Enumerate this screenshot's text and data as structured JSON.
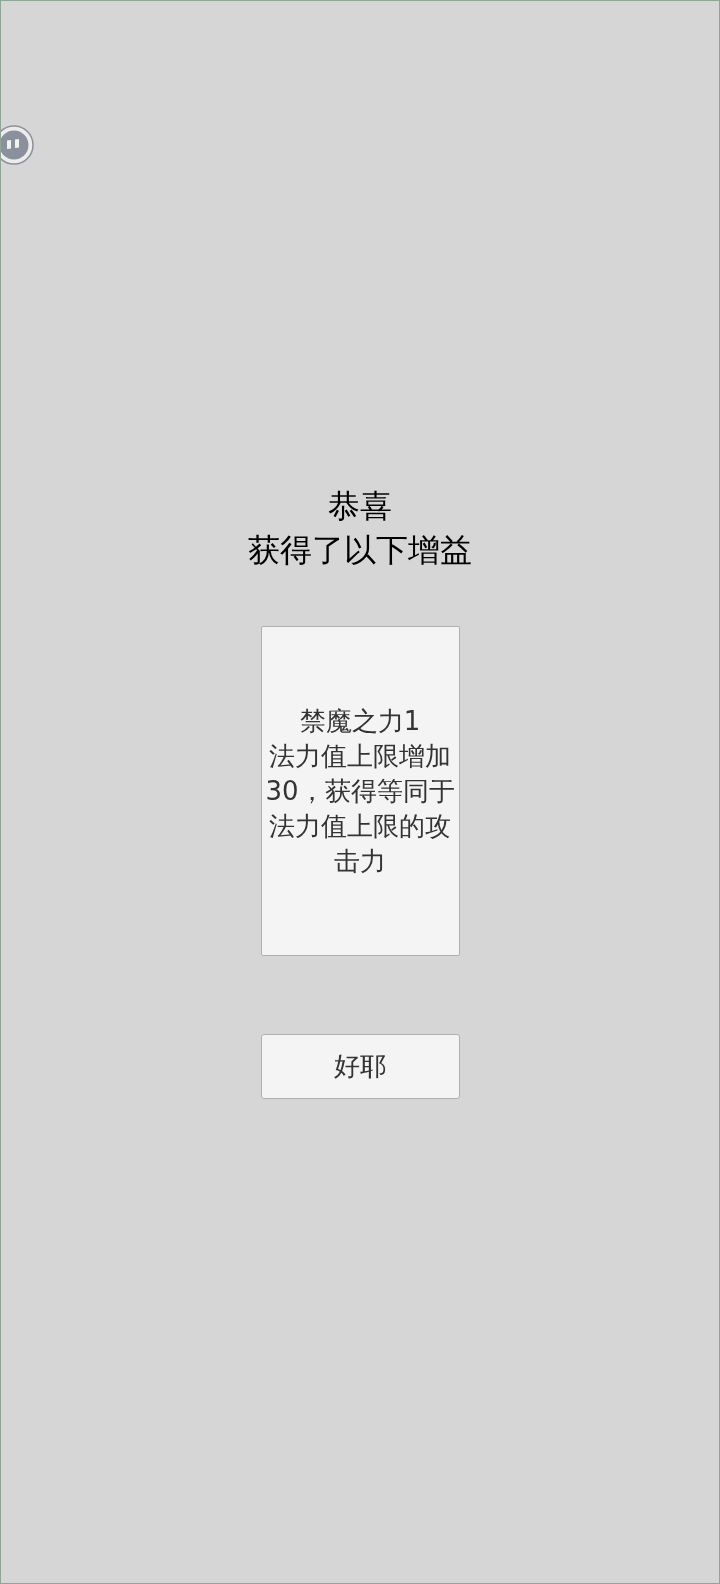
{
  "dialog": {
    "title": "恭喜",
    "subtitle": "获得了以下增益",
    "rewards": [
      {
        "name": "禁魔之力1",
        "description": "法力值上限增加30，获得等同于法力值上限的攻击力"
      }
    ],
    "confirm_button": "好耶"
  }
}
